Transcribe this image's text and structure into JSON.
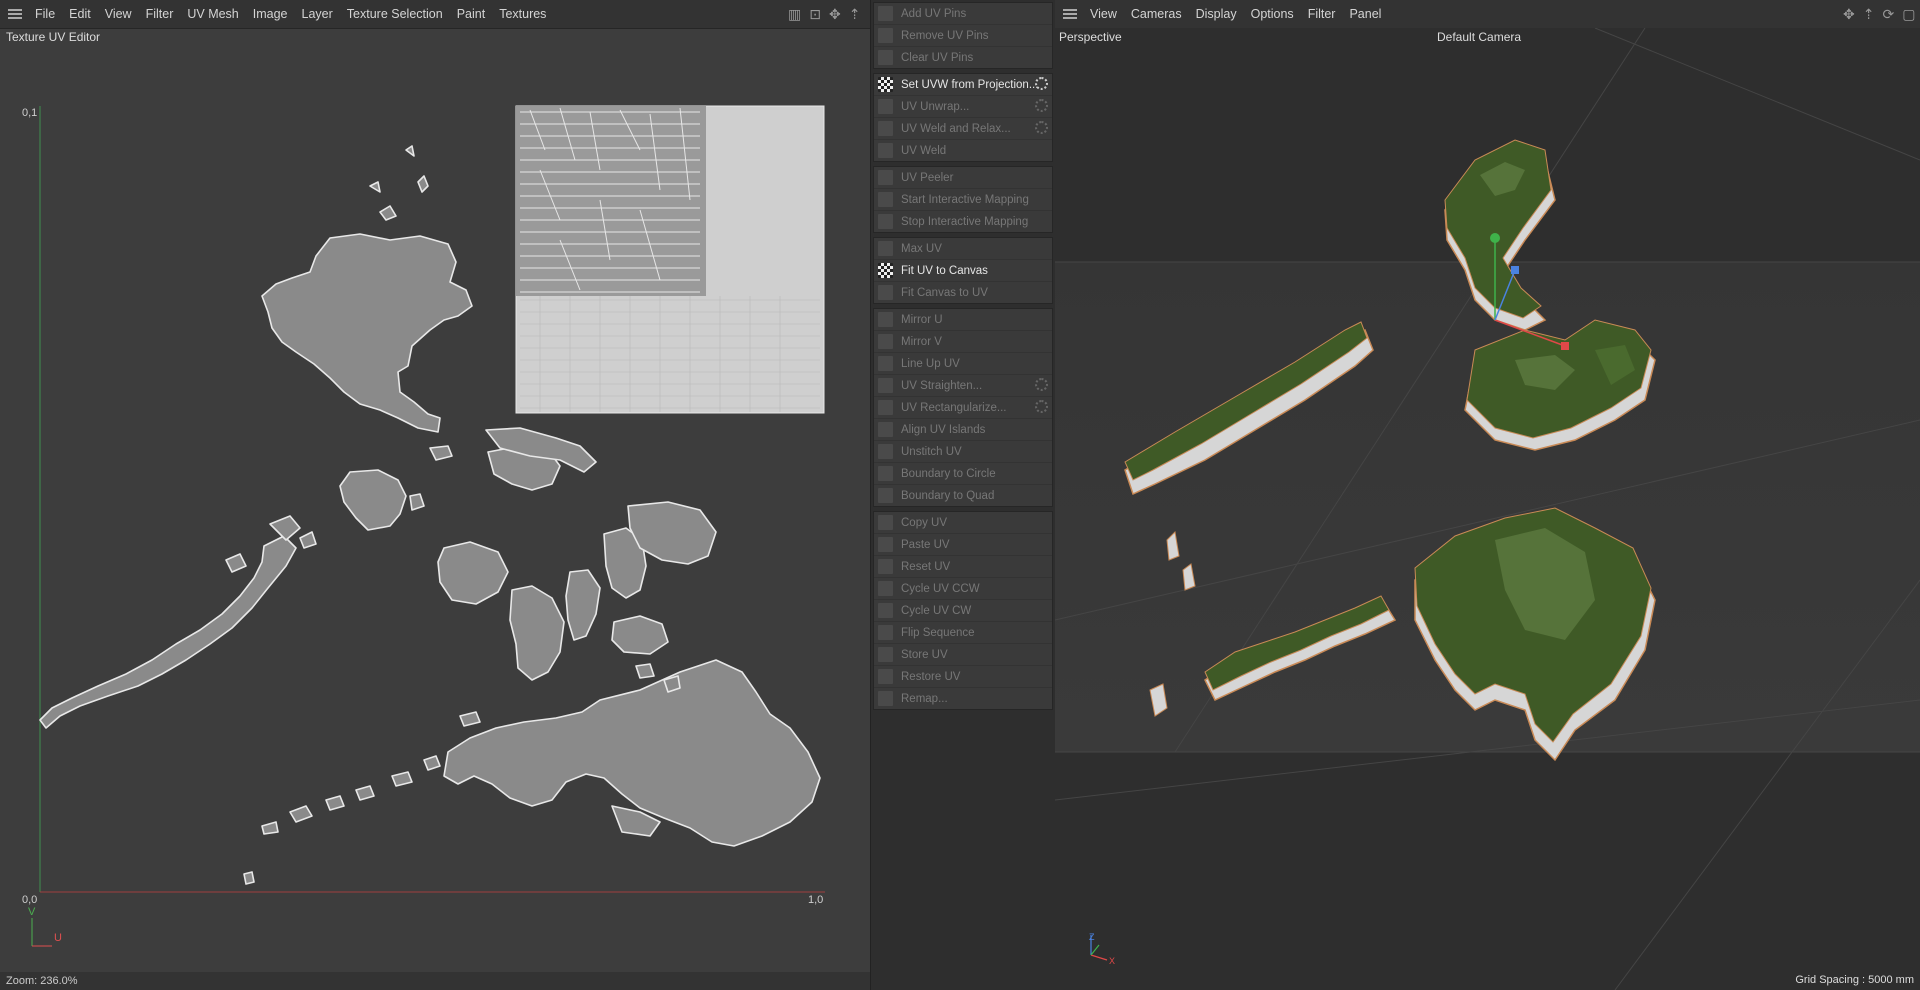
{
  "uv_editor": {
    "menu": [
      "File",
      "Edit",
      "View",
      "Filter",
      "UV Mesh",
      "Image",
      "Layer",
      "Texture Selection",
      "Paint",
      "Textures"
    ],
    "title": "Texture UV Editor",
    "axis_top": "0,1",
    "axis_origin": "0,0",
    "axis_right": "1,0",
    "axis_v": "V",
    "axis_u": "U",
    "zoom": "Zoom: 236.0%"
  },
  "commands": {
    "groups": [
      [
        {
          "label": "Add UV Pins",
          "active": false,
          "gear": false
        },
        {
          "label": "Remove UV Pins",
          "active": false,
          "gear": false
        },
        {
          "label": "Clear UV Pins",
          "active": false,
          "gear": false
        }
      ],
      [
        {
          "label": "Set UVW from Projection...",
          "active": true,
          "gear": true
        },
        {
          "label": "UV Unwrap...",
          "active": false,
          "gear": true
        },
        {
          "label": "UV Weld and Relax...",
          "active": false,
          "gear": true
        },
        {
          "label": "UV Weld",
          "active": false,
          "gear": false
        }
      ],
      [
        {
          "label": "UV Peeler",
          "active": false,
          "gear": false
        },
        {
          "label": "Start Interactive Mapping",
          "active": false,
          "gear": false
        },
        {
          "label": "Stop Interactive Mapping",
          "active": false,
          "gear": false
        }
      ],
      [
        {
          "label": "Max UV",
          "active": false,
          "gear": false
        },
        {
          "label": "Fit UV to Canvas",
          "active": true,
          "gear": false
        },
        {
          "label": "Fit Canvas to UV",
          "active": false,
          "gear": false
        }
      ],
      [
        {
          "label": "Mirror U",
          "active": false,
          "gear": false
        },
        {
          "label": "Mirror V",
          "active": false,
          "gear": false
        },
        {
          "label": "Line Up UV",
          "active": false,
          "gear": false
        },
        {
          "label": "UV Straighten...",
          "active": false,
          "gear": true
        },
        {
          "label": "UV Rectangularize...",
          "active": false,
          "gear": true
        },
        {
          "label": "Align UV Islands",
          "active": false,
          "gear": false
        },
        {
          "label": "Unstitch UV",
          "active": false,
          "gear": false
        },
        {
          "label": "Boundary to Circle",
          "active": false,
          "gear": false
        },
        {
          "label": "Boundary to Quad",
          "active": false,
          "gear": false
        }
      ],
      [
        {
          "label": "Copy UV",
          "active": false,
          "gear": false
        },
        {
          "label": "Paste UV",
          "active": false,
          "gear": false
        },
        {
          "label": "Reset UV",
          "active": false,
          "gear": false
        },
        {
          "label": "Cycle UV CCW",
          "active": false,
          "gear": false
        },
        {
          "label": "Cycle UV CW",
          "active": false,
          "gear": false
        },
        {
          "label": "Flip Sequence",
          "active": false,
          "gear": false
        },
        {
          "label": "Store UV",
          "active": false,
          "gear": false
        },
        {
          "label": "Restore UV",
          "active": false,
          "gear": false
        },
        {
          "label": "Remap...",
          "active": false,
          "gear": false
        }
      ]
    ]
  },
  "viewport": {
    "menu": [
      "View",
      "Cameras",
      "Display",
      "Options",
      "Filter",
      "Panel"
    ],
    "view_name": "Perspective",
    "camera": "Default Camera",
    "axis_z": "Z",
    "axis_x": "X",
    "grid_spacing": "Grid Spacing : 5000 mm"
  },
  "colors": {
    "uv_bg": "#3d3d3d",
    "island_fill": "#8a8a8a",
    "island_edge": "#e8e8e8",
    "terrain_green": "#3f5a26",
    "cliff_white": "#d6d6d6",
    "cliff_edge": "#c98a56"
  }
}
